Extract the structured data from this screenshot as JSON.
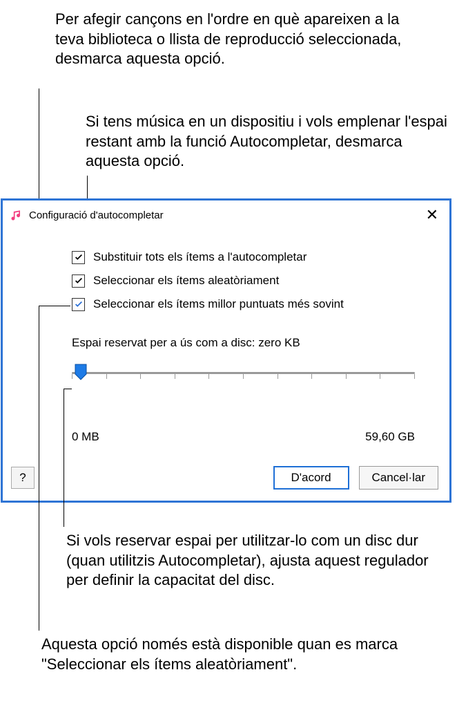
{
  "callouts": {
    "c1": "Per afegir cançons en l'ordre en què apareixen a la teva biblioteca o llista de reproducció seleccionada, desmarca aquesta opció.",
    "c2": "Si tens música en un dispositiu i vols emplenar l'espai restant amb la funció Autocompletar, desmarca aquesta opció.",
    "c3": "Si vols reservar espai per utilitzar-lo com un disc dur (quan utilitzis Autocompletar), ajusta aquest regulador per definir la capacitat del disc.",
    "c4": "Aquesta opció només està disponible quan es marca \"Seleccionar els ítems aleatòriament\"."
  },
  "dialog": {
    "title": "Configuració d'autocompletar",
    "options": {
      "replace_all": "Substituir tots els ítems a l'autocompletar",
      "random": "Seleccionar els ítems aleatòriament",
      "higher_rated": "Seleccionar els ítems millor puntuats més sovint"
    },
    "reserved_label": "Espai reservat per a ús com a disc: zero KB",
    "slider": {
      "min_label": "0 MB",
      "max_label": "59,60 GB"
    },
    "buttons": {
      "help": "?",
      "ok": "D'acord",
      "cancel": "Cancel·lar"
    }
  }
}
